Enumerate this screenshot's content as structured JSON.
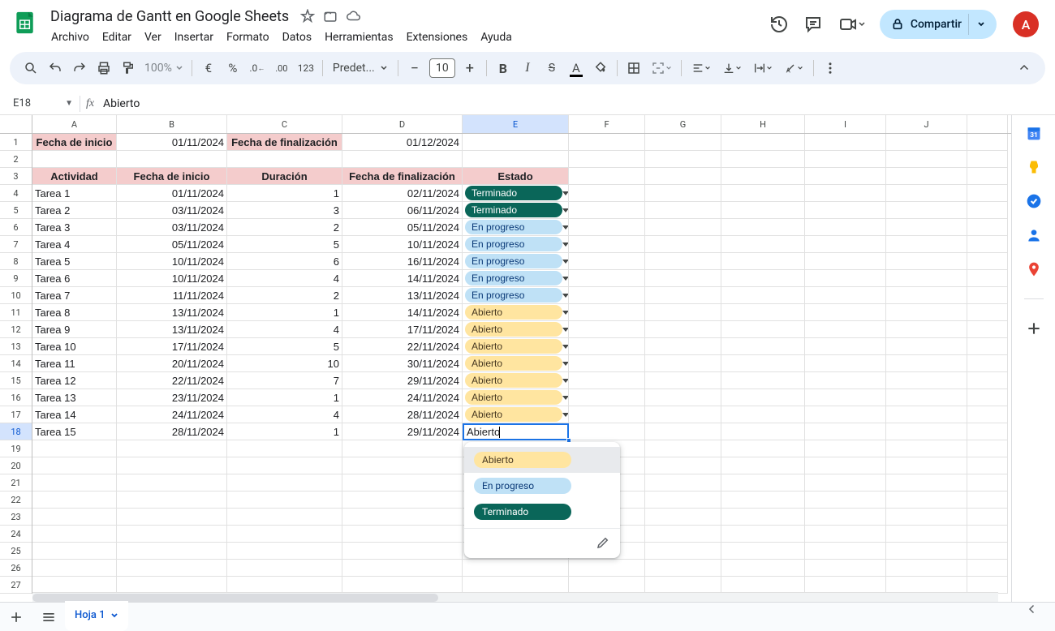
{
  "doc": {
    "title": "Diagrama de Gantt en Google Sheets"
  },
  "menu": {
    "file": "Archivo",
    "edit": "Editar",
    "view": "Ver",
    "insert": "Insertar",
    "format": "Formato",
    "data": "Datos",
    "tools": "Herramientas",
    "extensions": "Extensiones",
    "help": "Ayuda"
  },
  "header": {
    "share": "Compartir",
    "avatar": "A"
  },
  "toolbar": {
    "zoom": "100%",
    "font": "Predet...",
    "size": "10"
  },
  "namebox": "E18",
  "formula": "Abierto",
  "columns": [
    "A",
    "B",
    "C",
    "D",
    "E",
    "F",
    "G",
    "H",
    "I",
    "J"
  ],
  "row1": {
    "a": "Fecha de inicio",
    "b": "01/11/2024",
    "c": "Fecha de finalización",
    "d": "01/12/2024"
  },
  "headers": {
    "a": "Actividad",
    "b": "Fecha de inicio",
    "c": "Duración",
    "d": "Fecha de finalización",
    "e": "Estado"
  },
  "tasks": [
    {
      "a": "Tarea 1",
      "b": "01/11/2024",
      "c": "1",
      "d": "02/11/2024",
      "e": "Terminado",
      "cls": "terminado"
    },
    {
      "a": "Tarea 2",
      "b": "03/11/2024",
      "c": "3",
      "d": "06/11/2024",
      "e": "Terminado",
      "cls": "terminado"
    },
    {
      "a": "Tarea 3",
      "b": "03/11/2024",
      "c": "2",
      "d": "05/11/2024",
      "e": "En progreso",
      "cls": "progreso"
    },
    {
      "a": "Tarea 4",
      "b": "05/11/2024",
      "c": "5",
      "d": "10/11/2024",
      "e": "En progreso",
      "cls": "progreso"
    },
    {
      "a": "Tarea 5",
      "b": "10/11/2024",
      "c": "6",
      "d": "16/11/2024",
      "e": "En progreso",
      "cls": "progreso"
    },
    {
      "a": "Tarea 6",
      "b": "10/11/2024",
      "c": "4",
      "d": "14/11/2024",
      "e": "En progreso",
      "cls": "progreso"
    },
    {
      "a": "Tarea 7",
      "b": "11/11/2024",
      "c": "2",
      "d": "13/11/2024",
      "e": "En progreso",
      "cls": "progreso"
    },
    {
      "a": "Tarea 8",
      "b": "13/11/2024",
      "c": "1",
      "d": "14/11/2024",
      "e": "Abierto",
      "cls": "abierto"
    },
    {
      "a": "Tarea 9",
      "b": "13/11/2024",
      "c": "4",
      "d": "17/11/2024",
      "e": "Abierto",
      "cls": "abierto"
    },
    {
      "a": "Tarea 10",
      "b": "17/11/2024",
      "c": "5",
      "d": "22/11/2024",
      "e": "Abierto",
      "cls": "abierto"
    },
    {
      "a": "Tarea 11",
      "b": "20/11/2024",
      "c": "10",
      "d": "30/11/2024",
      "e": "Abierto",
      "cls": "abierto"
    },
    {
      "a": "Tarea 12",
      "b": "22/11/2024",
      "c": "7",
      "d": "29/11/2024",
      "e": "Abierto",
      "cls": "abierto"
    },
    {
      "a": "Tarea 13",
      "b": "23/11/2024",
      "c": "1",
      "d": "24/11/2024",
      "e": "Abierto",
      "cls": "abierto"
    },
    {
      "a": "Tarea 14",
      "b": "24/11/2024",
      "c": "4",
      "d": "28/11/2024",
      "e": "Abierto",
      "cls": "abierto"
    },
    {
      "a": "Tarea 15",
      "b": "28/11/2024",
      "c": "1",
      "d": "29/11/2024",
      "e": "",
      "cls": ""
    }
  ],
  "editing": {
    "value": "Abierto"
  },
  "dropdown": {
    "options": [
      {
        "label": "Abierto",
        "cls": "abierto"
      },
      {
        "label": "En progreso",
        "cls": "progreso"
      },
      {
        "label": "Terminado",
        "cls": "terminado"
      }
    ]
  },
  "tabs": {
    "sheet1": "Hoja 1"
  }
}
